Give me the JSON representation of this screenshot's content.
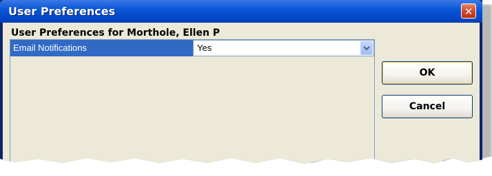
{
  "window": {
    "title": "User Preferences",
    "close_glyph": "✕"
  },
  "dialog": {
    "heading": "User Preferences for Morthole, Ellen P",
    "preferences": [
      {
        "label": "Email Notifications",
        "value": "Yes",
        "icon": "chevron-down-icon"
      }
    ]
  },
  "buttons": {
    "ok_label": "OK",
    "cancel_label": "Cancel"
  },
  "colors": {
    "titlebar": "#0a58d8",
    "selected_row": "#316ac5",
    "client_bg": "#ece9d8",
    "close_button": "#d2482a"
  }
}
